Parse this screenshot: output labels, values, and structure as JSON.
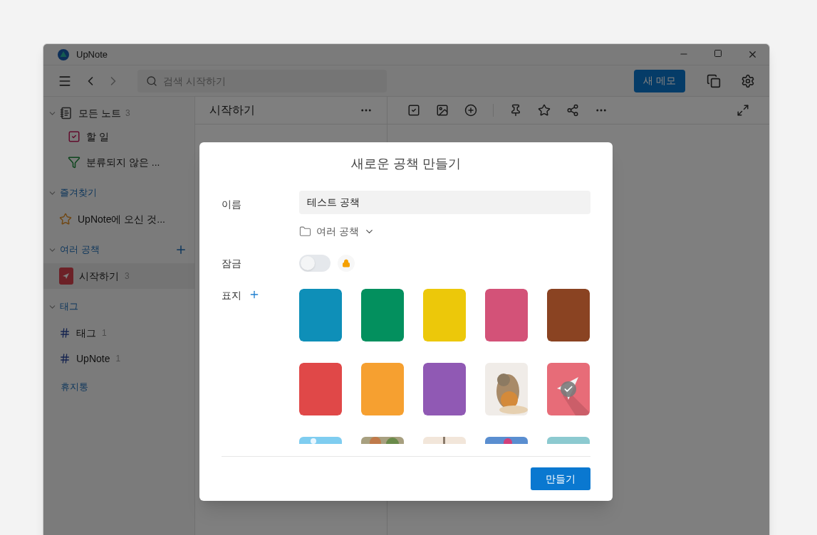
{
  "window": {
    "title": "UpNote"
  },
  "toolbar": {
    "search_placeholder": "검색 시작하기",
    "new_button": "새 메모"
  },
  "sidebar": [
    {
      "kind": "all",
      "label": "모든 노트",
      "count": "3",
      "expanded": true,
      "children": [
        {
          "kind": "todo",
          "label": "할 일"
        },
        {
          "kind": "filter",
          "label": "분류되지 않은 ..."
        }
      ]
    },
    {
      "kind": "section",
      "label": "즐겨찾기",
      "expanded": true,
      "children": [
        {
          "kind": "star",
          "label": "UpNote에 오신 것..."
        }
      ]
    },
    {
      "kind": "section",
      "label": "여러 공책",
      "expanded": true,
      "addable": true,
      "children": [
        {
          "kind": "notebook",
          "label": "시작하기",
          "count": "3",
          "selected": true
        }
      ]
    },
    {
      "kind": "section",
      "label": "태그",
      "expanded": true,
      "children": [
        {
          "kind": "tag",
          "label": "태그",
          "count": "1"
        },
        {
          "kind": "tag",
          "label": "UpNote",
          "count": "1"
        }
      ]
    },
    {
      "kind": "link",
      "label": "휴지통"
    }
  ],
  "note_list": {
    "title": "시작하기"
  },
  "dialog": {
    "title": "새로운 공책 만들기",
    "name_label": "이름",
    "name_value": "테스트 공책",
    "folder": "여러 공책",
    "lock_label": "잠금",
    "lock_on": false,
    "cover_label": "표지",
    "covers": [
      {
        "kind": "color",
        "color": "#0e8fb8",
        "selected": false
      },
      {
        "kind": "color",
        "color": "#03905e",
        "selected": false
      },
      {
        "kind": "color",
        "color": "#ecc80a",
        "selected": false
      },
      {
        "kind": "color",
        "color": "#d35278",
        "selected": false
      },
      {
        "kind": "color",
        "color": "#8a4322",
        "selected": false
      },
      {
        "kind": "color",
        "color": "#e04848",
        "selected": false
      },
      {
        "kind": "color",
        "color": "#f6a030",
        "selected": false
      },
      {
        "kind": "color",
        "color": "#9059b4",
        "selected": false
      },
      {
        "kind": "picture",
        "selected": false
      },
      {
        "kind": "plane",
        "color": "#e76c78",
        "selected": true
      },
      {
        "kind": "picture",
        "selected": false
      },
      {
        "kind": "picture",
        "selected": false
      },
      {
        "kind": "picture",
        "selected": false
      },
      {
        "kind": "picture",
        "selected": false
      },
      {
        "kind": "picture",
        "selected": false
      }
    ],
    "create_button": "만들기"
  }
}
